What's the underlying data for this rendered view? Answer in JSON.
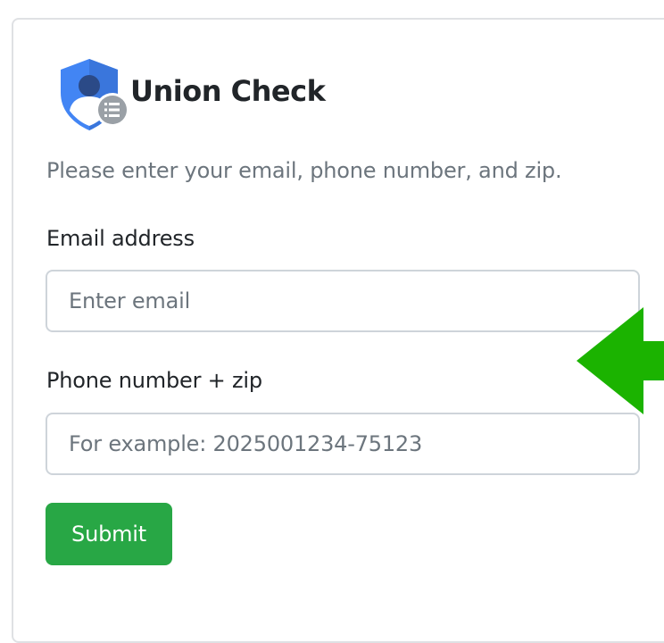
{
  "app": {
    "title": "Union Check"
  },
  "form": {
    "instructions": "Please enter your email, phone number, and zip.",
    "email": {
      "label": "Email address",
      "value": "",
      "placeholder": "Enter email"
    },
    "phone": {
      "label": "Phone number + zip",
      "value": "",
      "placeholder": "For example: 2025001234-75123"
    },
    "submit_label": "Submit"
  },
  "icons": {
    "logo": "shield-user-icon",
    "logo_badge": "list-icon",
    "pointer": "arrow-left-icon"
  },
  "colors": {
    "shield_blue": "#4285f4",
    "submit_green": "#28a745",
    "arrow_green": "#1bb300",
    "muted_text": "#6c757d",
    "border": "#ced4da"
  }
}
